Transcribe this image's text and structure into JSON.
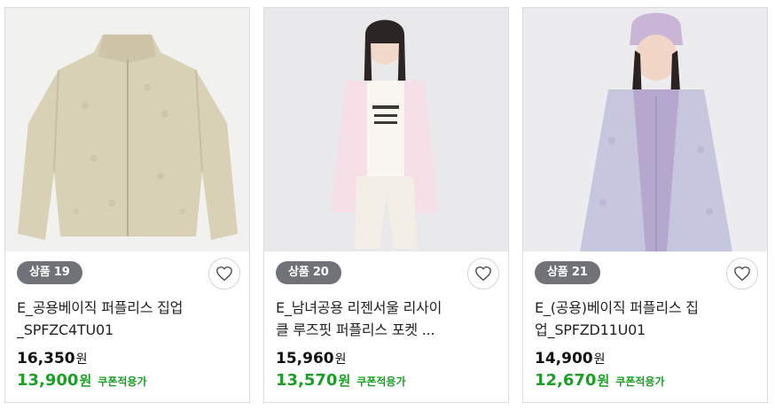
{
  "products": [
    {
      "badge": "상품 19",
      "title_line1": "E_공용베이직 퍼플리스 집업",
      "title_line2": "_SPFZC4TU01",
      "price": "16,350",
      "sale_price": "13,900",
      "currency": "원",
      "coupon_label": "쿠폰적용가",
      "image_icon": "beige-fleece-jacket",
      "wish_icon": "heart-icon"
    },
    {
      "badge": "상품 20",
      "title_line1": "E_남녀공용 리젠서울 리사이",
      "title_line2": "클 루즈핏 퍼플리스 포켓 ...",
      "price": "15,960",
      "sale_price": "13,570",
      "currency": "원",
      "coupon_label": "쿠폰적용가",
      "image_icon": "model-pink-fleece",
      "wish_icon": "heart-icon"
    },
    {
      "badge": "상품 21",
      "title_line1": "E_(공용)베이직 퍼플리스 집",
      "title_line2": "업_SPFZD11U01",
      "price": "14,900",
      "sale_price": "12,670",
      "currency": "원",
      "coupon_label": "쿠폰적용가",
      "image_icon": "model-lavender-fleece",
      "wish_icon": "heart-icon"
    }
  ],
  "colors": {
    "badge_bg": "#6f7377",
    "sale_green": "#1aa024",
    "border": "#dcdcdc"
  }
}
